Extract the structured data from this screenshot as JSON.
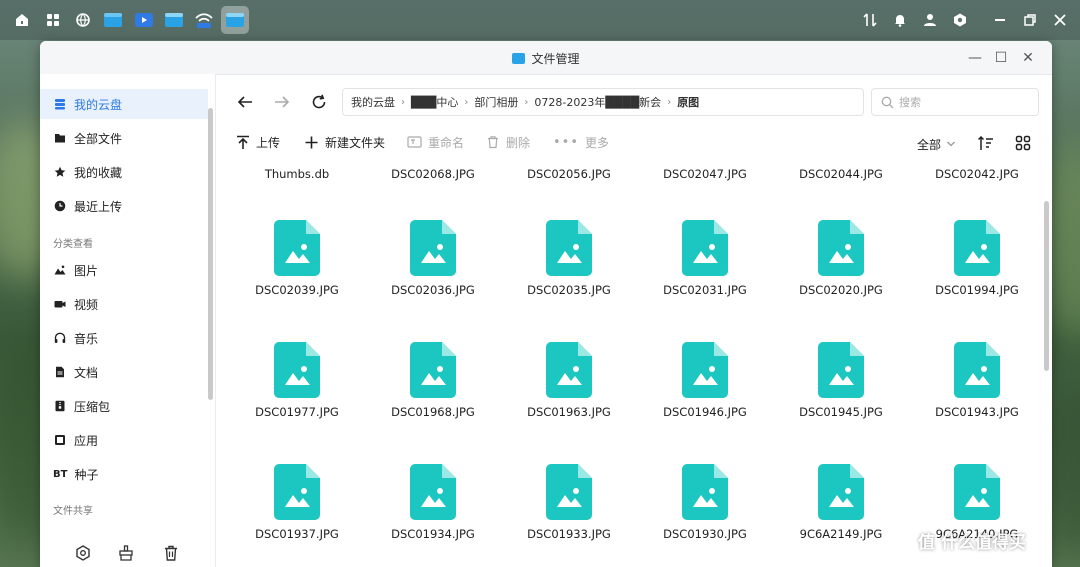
{
  "taskbar": {
    "left_icons": [
      "home-icon",
      "apps-grid-icon",
      "globe-icon",
      "folder-app-icon",
      "video-player-icon",
      "file-manager-icon",
      "wifi-app-icon",
      "file-manager-active-icon"
    ],
    "right_icons": [
      "transfer-icon",
      "bell-icon",
      "user-icon",
      "settings-hex-icon",
      "minimize-all-icon",
      "restore-icon",
      "close-icon"
    ]
  },
  "window": {
    "title": "文件管理",
    "controls": [
      "—",
      "☐",
      "✕"
    ]
  },
  "sidebar": {
    "items": [
      {
        "label": "我的云盘",
        "icon": "drive-icon",
        "active": true
      },
      {
        "label": "全部文件",
        "icon": "folder-icon",
        "active": false
      },
      {
        "label": "我的收藏",
        "icon": "star-icon",
        "active": false
      },
      {
        "label": "最近上传",
        "icon": "clock-icon",
        "active": false
      }
    ],
    "section_categories": "分类查看",
    "category_items": [
      {
        "label": "图片",
        "icon": "image-icon"
      },
      {
        "label": "视频",
        "icon": "video-icon"
      },
      {
        "label": "音乐",
        "icon": "headphones-icon"
      },
      {
        "label": "文档",
        "icon": "document-icon"
      },
      {
        "label": "压缩包",
        "icon": "archive-icon"
      },
      {
        "label": "应用",
        "icon": "app-icon"
      },
      {
        "label": "种子",
        "icon": "bt-icon",
        "icon_text": "BT"
      }
    ],
    "section_share": "文件共享"
  },
  "breadcrumb": {
    "items": [
      {
        "label": "我的云盘",
        "blur": false
      },
      {
        "label": "███中心",
        "blur": false
      },
      {
        "label": "部门相册",
        "blur": false
      },
      {
        "label": "0728-2023年████新会",
        "blur": false
      },
      {
        "label": "原图",
        "blur": false,
        "current": true
      }
    ]
  },
  "search": {
    "placeholder": "搜索"
  },
  "toolbar": {
    "upload": "上传",
    "new_folder": "新建文件夹",
    "rename": "重命名",
    "delete": "删除",
    "more": "更多",
    "filter": "全部"
  },
  "files": {
    "row0": [
      "Thumbs.db",
      "DSC02068.JPG",
      "DSC02056.JPG",
      "DSC02047.JPG",
      "DSC02044.JPG",
      "DSC02042.JPG"
    ],
    "row1": [
      "DSC02039.JPG",
      "DSC02036.JPG",
      "DSC02035.JPG",
      "DSC02031.JPG",
      "DSC02020.JPG",
      "DSC01994.JPG"
    ],
    "row2": [
      "DSC01977.JPG",
      "DSC01968.JPG",
      "DSC01963.JPG",
      "DSC01946.JPG",
      "DSC01945.JPG",
      "DSC01943.JPG"
    ],
    "row3": [
      "DSC01937.JPG",
      "DSC01934.JPG",
      "DSC01933.JPG",
      "DSC01930.JPG",
      "9C6A2149.JPG",
      "9C6A2140.JPG"
    ]
  },
  "watermark": "值 什么值得买",
  "colors": {
    "accent": "#2f7ae5",
    "file_icon": "#1cc7c1"
  }
}
